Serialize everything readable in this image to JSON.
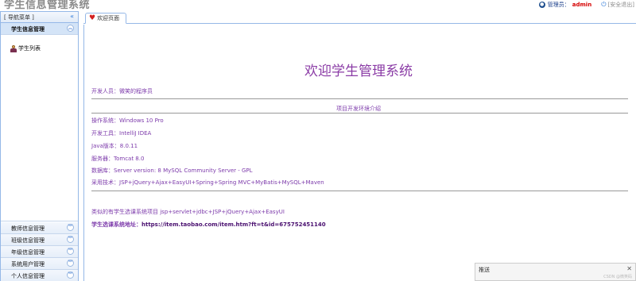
{
  "header": {
    "title": "学生信息管理系统",
    "user_label": "管理员：",
    "user_name": "admin",
    "logout": "[安全退出]"
  },
  "sidebar": {
    "title": "[ 导航菜单 ]",
    "collapse_icon": "double-left-chevron",
    "active_menu": "学生信息管理",
    "sub_items": [
      {
        "label": "学生列表",
        "icon": "student-icon"
      }
    ],
    "menus": [
      "教师信息管理",
      "班级信息管理",
      "年级信息管理",
      "系统用户管理",
      "个人信息管理"
    ]
  },
  "tabs": [
    {
      "label": "欢迎页面",
      "icon": "heart-icon"
    }
  ],
  "content": {
    "welcome": "欢迎学生管理系统",
    "developer": "开发人员：微笑的程序员",
    "section_title": "项目开发环境介绍",
    "env": [
      "操作系统：Windows 10 Pro",
      "开发工具：IntelliJ IDEA",
      "Java版本：8.0.11",
      "服务器：Tomcat 8.0",
      "数据库：Server version: 8 MySQL Community Server - GPL",
      "采用技术：JSP+jQuery+Ajax+EasyUI+Spring+Spring MVC+MyBatis+MySQL+Maven"
    ],
    "similar": "类似的有学生选课系统项目   jsp+servlet+jdbc+JSP+jQuery+Ajax+EasyUI",
    "link_label": "学生选课系统地址：",
    "link_url": "https://item.taobao.com/item.htm?ft=t&id=675752451140"
  },
  "popup": {
    "title": "推送",
    "watermark": "CSDN @微笑码"
  },
  "colors": {
    "accent": "#7d3bab",
    "border": "#95b8e7",
    "admin": "#d50000"
  }
}
